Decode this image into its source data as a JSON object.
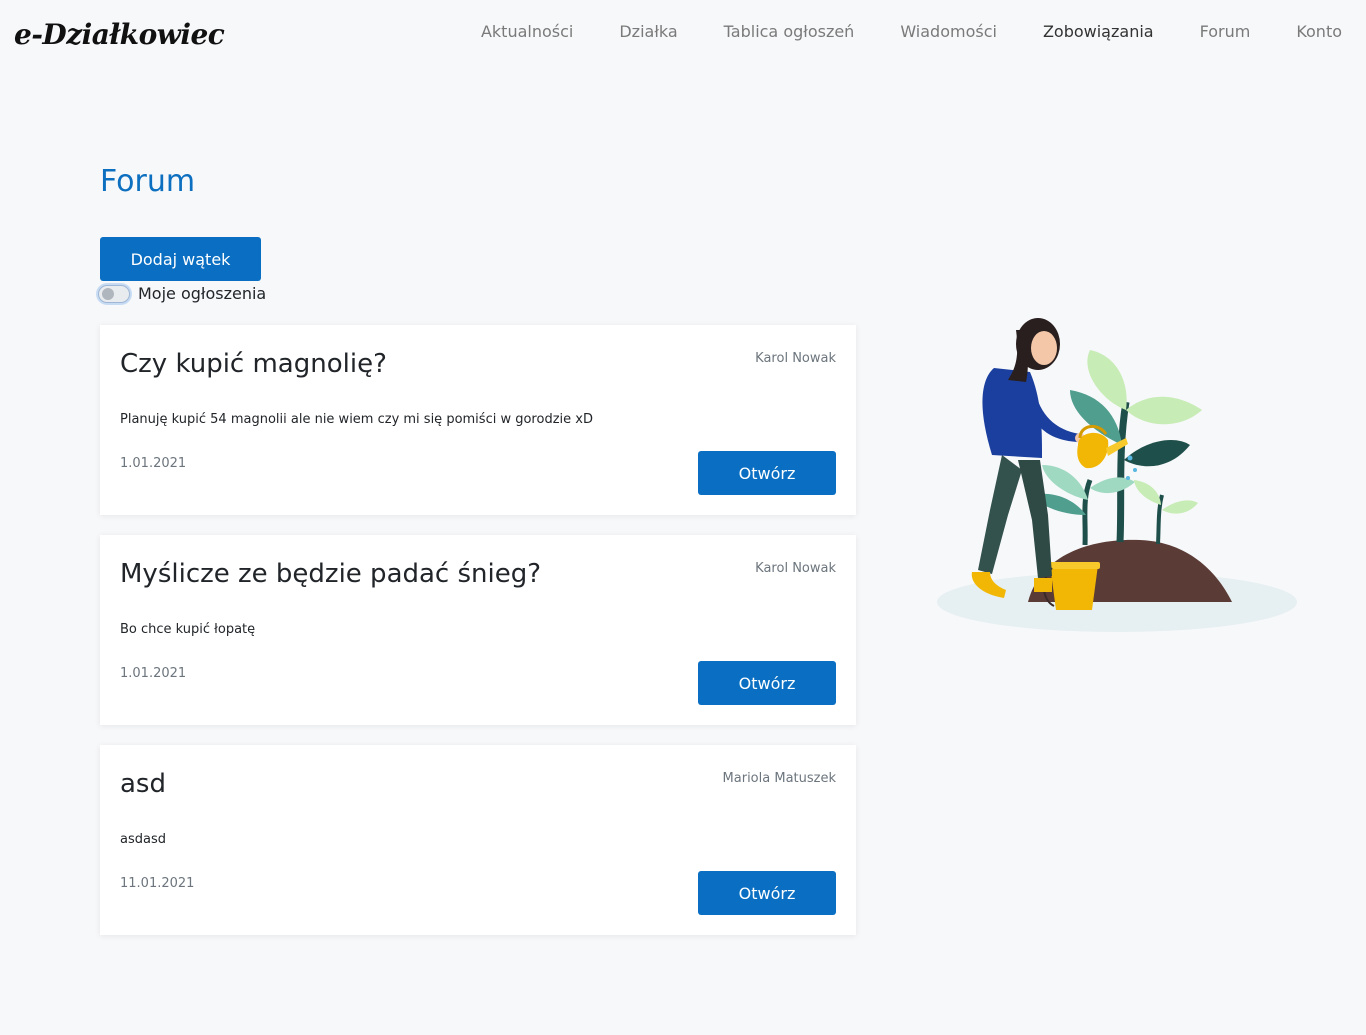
{
  "brand": "e-Działkowiec",
  "nav": [
    {
      "label": "Aktualności",
      "active": false
    },
    {
      "label": "Działka",
      "active": false
    },
    {
      "label": "Tablica ogłoszeń",
      "active": false
    },
    {
      "label": "Wiadomości",
      "active": false
    },
    {
      "label": "Zobowiązania",
      "active": true
    },
    {
      "label": "Forum",
      "active": false
    },
    {
      "label": "Konto",
      "active": false
    }
  ],
  "page": {
    "title": "Forum",
    "add_button": "Dodaj wątek",
    "toggle_label": "Moje ogłoszenia",
    "toggle_on": false
  },
  "threads": [
    {
      "title": "Czy kupić magnolię?",
      "author": "Karol Nowak",
      "body": "Planuję kupić 54 magnolii ale nie wiem czy mi się pomiści w gorodzie xD",
      "date": "1.01.2021",
      "open_label": "Otwórz"
    },
    {
      "title": "Myślicze ze będzie padać śnieg?",
      "author": "Karol Nowak",
      "body": "Bo chce kupić łopatę",
      "date": "1.01.2021",
      "open_label": "Otwórz"
    },
    {
      "title": "asd",
      "author": "Mariola Matuszek",
      "body": "asdasd",
      "date": "11.01.2021",
      "open_label": "Otwórz"
    }
  ],
  "colors": {
    "primary": "#0a6fc2",
    "title": "#0d6fbf",
    "background": "#f7f8fa"
  },
  "illustration": "gardener-watering-plants-illustration"
}
